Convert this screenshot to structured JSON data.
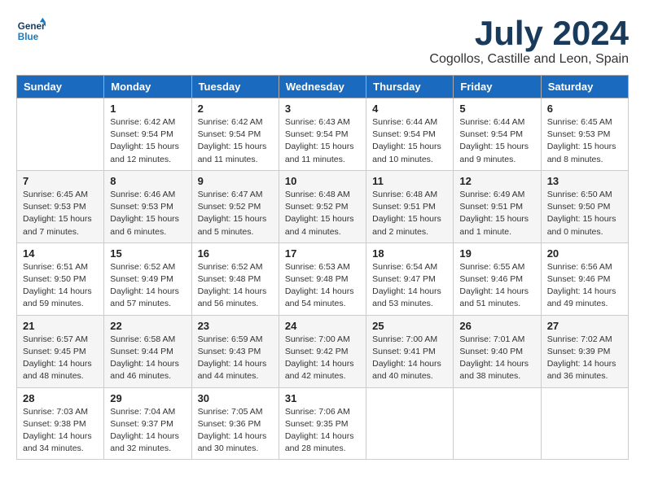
{
  "logo": {
    "line1": "General",
    "line2": "Blue"
  },
  "title": "July 2024",
  "location": "Cogollos, Castille and Leon, Spain",
  "days_header": [
    "Sunday",
    "Monday",
    "Tuesday",
    "Wednesday",
    "Thursday",
    "Friday",
    "Saturday"
  ],
  "weeks": [
    [
      {
        "day": "",
        "info": ""
      },
      {
        "day": "1",
        "info": "Sunrise: 6:42 AM\nSunset: 9:54 PM\nDaylight: 15 hours\nand 12 minutes."
      },
      {
        "day": "2",
        "info": "Sunrise: 6:42 AM\nSunset: 9:54 PM\nDaylight: 15 hours\nand 11 minutes."
      },
      {
        "day": "3",
        "info": "Sunrise: 6:43 AM\nSunset: 9:54 PM\nDaylight: 15 hours\nand 11 minutes."
      },
      {
        "day": "4",
        "info": "Sunrise: 6:44 AM\nSunset: 9:54 PM\nDaylight: 15 hours\nand 10 minutes."
      },
      {
        "day": "5",
        "info": "Sunrise: 6:44 AM\nSunset: 9:54 PM\nDaylight: 15 hours\nand 9 minutes."
      },
      {
        "day": "6",
        "info": "Sunrise: 6:45 AM\nSunset: 9:53 PM\nDaylight: 15 hours\nand 8 minutes."
      }
    ],
    [
      {
        "day": "7",
        "info": "Sunrise: 6:45 AM\nSunset: 9:53 PM\nDaylight: 15 hours\nand 7 minutes."
      },
      {
        "day": "8",
        "info": "Sunrise: 6:46 AM\nSunset: 9:53 PM\nDaylight: 15 hours\nand 6 minutes."
      },
      {
        "day": "9",
        "info": "Sunrise: 6:47 AM\nSunset: 9:52 PM\nDaylight: 15 hours\nand 5 minutes."
      },
      {
        "day": "10",
        "info": "Sunrise: 6:48 AM\nSunset: 9:52 PM\nDaylight: 15 hours\nand 4 minutes."
      },
      {
        "day": "11",
        "info": "Sunrise: 6:48 AM\nSunset: 9:51 PM\nDaylight: 15 hours\nand 2 minutes."
      },
      {
        "day": "12",
        "info": "Sunrise: 6:49 AM\nSunset: 9:51 PM\nDaylight: 15 hours\nand 1 minute."
      },
      {
        "day": "13",
        "info": "Sunrise: 6:50 AM\nSunset: 9:50 PM\nDaylight: 15 hours\nand 0 minutes."
      }
    ],
    [
      {
        "day": "14",
        "info": "Sunrise: 6:51 AM\nSunset: 9:50 PM\nDaylight: 14 hours\nand 59 minutes."
      },
      {
        "day": "15",
        "info": "Sunrise: 6:52 AM\nSunset: 9:49 PM\nDaylight: 14 hours\nand 57 minutes."
      },
      {
        "day": "16",
        "info": "Sunrise: 6:52 AM\nSunset: 9:48 PM\nDaylight: 14 hours\nand 56 minutes."
      },
      {
        "day": "17",
        "info": "Sunrise: 6:53 AM\nSunset: 9:48 PM\nDaylight: 14 hours\nand 54 minutes."
      },
      {
        "day": "18",
        "info": "Sunrise: 6:54 AM\nSunset: 9:47 PM\nDaylight: 14 hours\nand 53 minutes."
      },
      {
        "day": "19",
        "info": "Sunrise: 6:55 AM\nSunset: 9:46 PM\nDaylight: 14 hours\nand 51 minutes."
      },
      {
        "day": "20",
        "info": "Sunrise: 6:56 AM\nSunset: 9:46 PM\nDaylight: 14 hours\nand 49 minutes."
      }
    ],
    [
      {
        "day": "21",
        "info": "Sunrise: 6:57 AM\nSunset: 9:45 PM\nDaylight: 14 hours\nand 48 minutes."
      },
      {
        "day": "22",
        "info": "Sunrise: 6:58 AM\nSunset: 9:44 PM\nDaylight: 14 hours\nand 46 minutes."
      },
      {
        "day": "23",
        "info": "Sunrise: 6:59 AM\nSunset: 9:43 PM\nDaylight: 14 hours\nand 44 minutes."
      },
      {
        "day": "24",
        "info": "Sunrise: 7:00 AM\nSunset: 9:42 PM\nDaylight: 14 hours\nand 42 minutes."
      },
      {
        "day": "25",
        "info": "Sunrise: 7:00 AM\nSunset: 9:41 PM\nDaylight: 14 hours\nand 40 minutes."
      },
      {
        "day": "26",
        "info": "Sunrise: 7:01 AM\nSunset: 9:40 PM\nDaylight: 14 hours\nand 38 minutes."
      },
      {
        "day": "27",
        "info": "Sunrise: 7:02 AM\nSunset: 9:39 PM\nDaylight: 14 hours\nand 36 minutes."
      }
    ],
    [
      {
        "day": "28",
        "info": "Sunrise: 7:03 AM\nSunset: 9:38 PM\nDaylight: 14 hours\nand 34 minutes."
      },
      {
        "day": "29",
        "info": "Sunrise: 7:04 AM\nSunset: 9:37 PM\nDaylight: 14 hours\nand 32 minutes."
      },
      {
        "day": "30",
        "info": "Sunrise: 7:05 AM\nSunset: 9:36 PM\nDaylight: 14 hours\nand 30 minutes."
      },
      {
        "day": "31",
        "info": "Sunrise: 7:06 AM\nSunset: 9:35 PM\nDaylight: 14 hours\nand 28 minutes."
      },
      {
        "day": "",
        "info": ""
      },
      {
        "day": "",
        "info": ""
      },
      {
        "day": "",
        "info": ""
      }
    ]
  ]
}
